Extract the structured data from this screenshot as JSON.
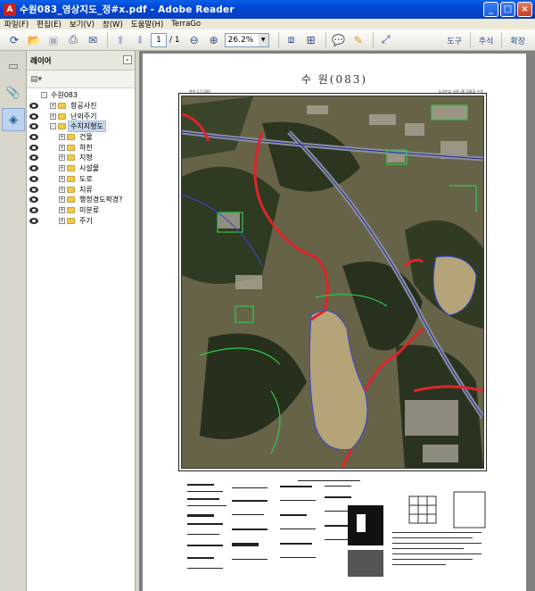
{
  "window": {
    "title": "수원083_영상지도_정#x.pdf - Adobe Reader",
    "controls": {
      "minimize": "_",
      "maximize": "□",
      "close": "×"
    }
  },
  "menu": [
    "파일(F)",
    "편집(E)",
    "보기(V)",
    "창(W)",
    "도움말(H)",
    "TerraGo"
  ],
  "toolbar": {
    "page_current": "1",
    "page_total": "/ 1",
    "zoom": "26.2%",
    "right_buttons": [
      "도구",
      "주석",
      "확장"
    ]
  },
  "panel": {
    "title": "레이어",
    "close": "-",
    "options": "▤▾",
    "tree": [
      {
        "label": "수원083",
        "level": 0,
        "expander": "-",
        "folder": false,
        "eye": false,
        "selected": false
      },
      {
        "label": "항공사진",
        "level": 1,
        "expander": "+",
        "folder": true,
        "eye": true,
        "selected": false
      },
      {
        "label": "난외주기",
        "level": 1,
        "expander": "+",
        "folder": true,
        "eye": true,
        "selected": false
      },
      {
        "label": "수치지형도",
        "level": 1,
        "expander": "-",
        "folder": true,
        "eye": true,
        "selected": true
      },
      {
        "label": "건물",
        "level": 2,
        "expander": "+",
        "folder": true,
        "eye": true,
        "selected": false
      },
      {
        "label": "하천",
        "level": 2,
        "expander": "+",
        "folder": true,
        "eye": true,
        "selected": false
      },
      {
        "label": "지형",
        "level": 2,
        "expander": "+",
        "folder": true,
        "eye": true,
        "selected": false
      },
      {
        "label": "시설물",
        "level": 2,
        "expander": "+",
        "folder": true,
        "eye": true,
        "selected": false
      },
      {
        "label": "도로",
        "level": 2,
        "expander": "+",
        "folder": true,
        "eye": true,
        "selected": false
      },
      {
        "label": "지류",
        "level": 2,
        "expander": "+",
        "folder": true,
        "eye": true,
        "selected": false
      },
      {
        "label": "행정경도팍경?",
        "level": 2,
        "expander": "+",
        "folder": true,
        "eye": true,
        "selected": false
      },
      {
        "label": "미분류",
        "level": 2,
        "expander": "+",
        "folder": true,
        "eye": true,
        "selected": false
      },
      {
        "label": "주기",
        "level": 2,
        "expander": "+",
        "folder": true,
        "eye": true,
        "selected": false
      }
    ]
  },
  "document": {
    "map_title": "수  원(083)",
    "scale_note": "축척 1:5,000",
    "right_note": "도엽번호 서울 36 (083) 수원"
  },
  "colors": {
    "titlebar": "#0a5fe8",
    "selection": "#c6d8ee",
    "doc_bg": "#808080",
    "road_red": "#e0242a",
    "contour_green": "#2fc84a",
    "water": "#b4a477"
  }
}
